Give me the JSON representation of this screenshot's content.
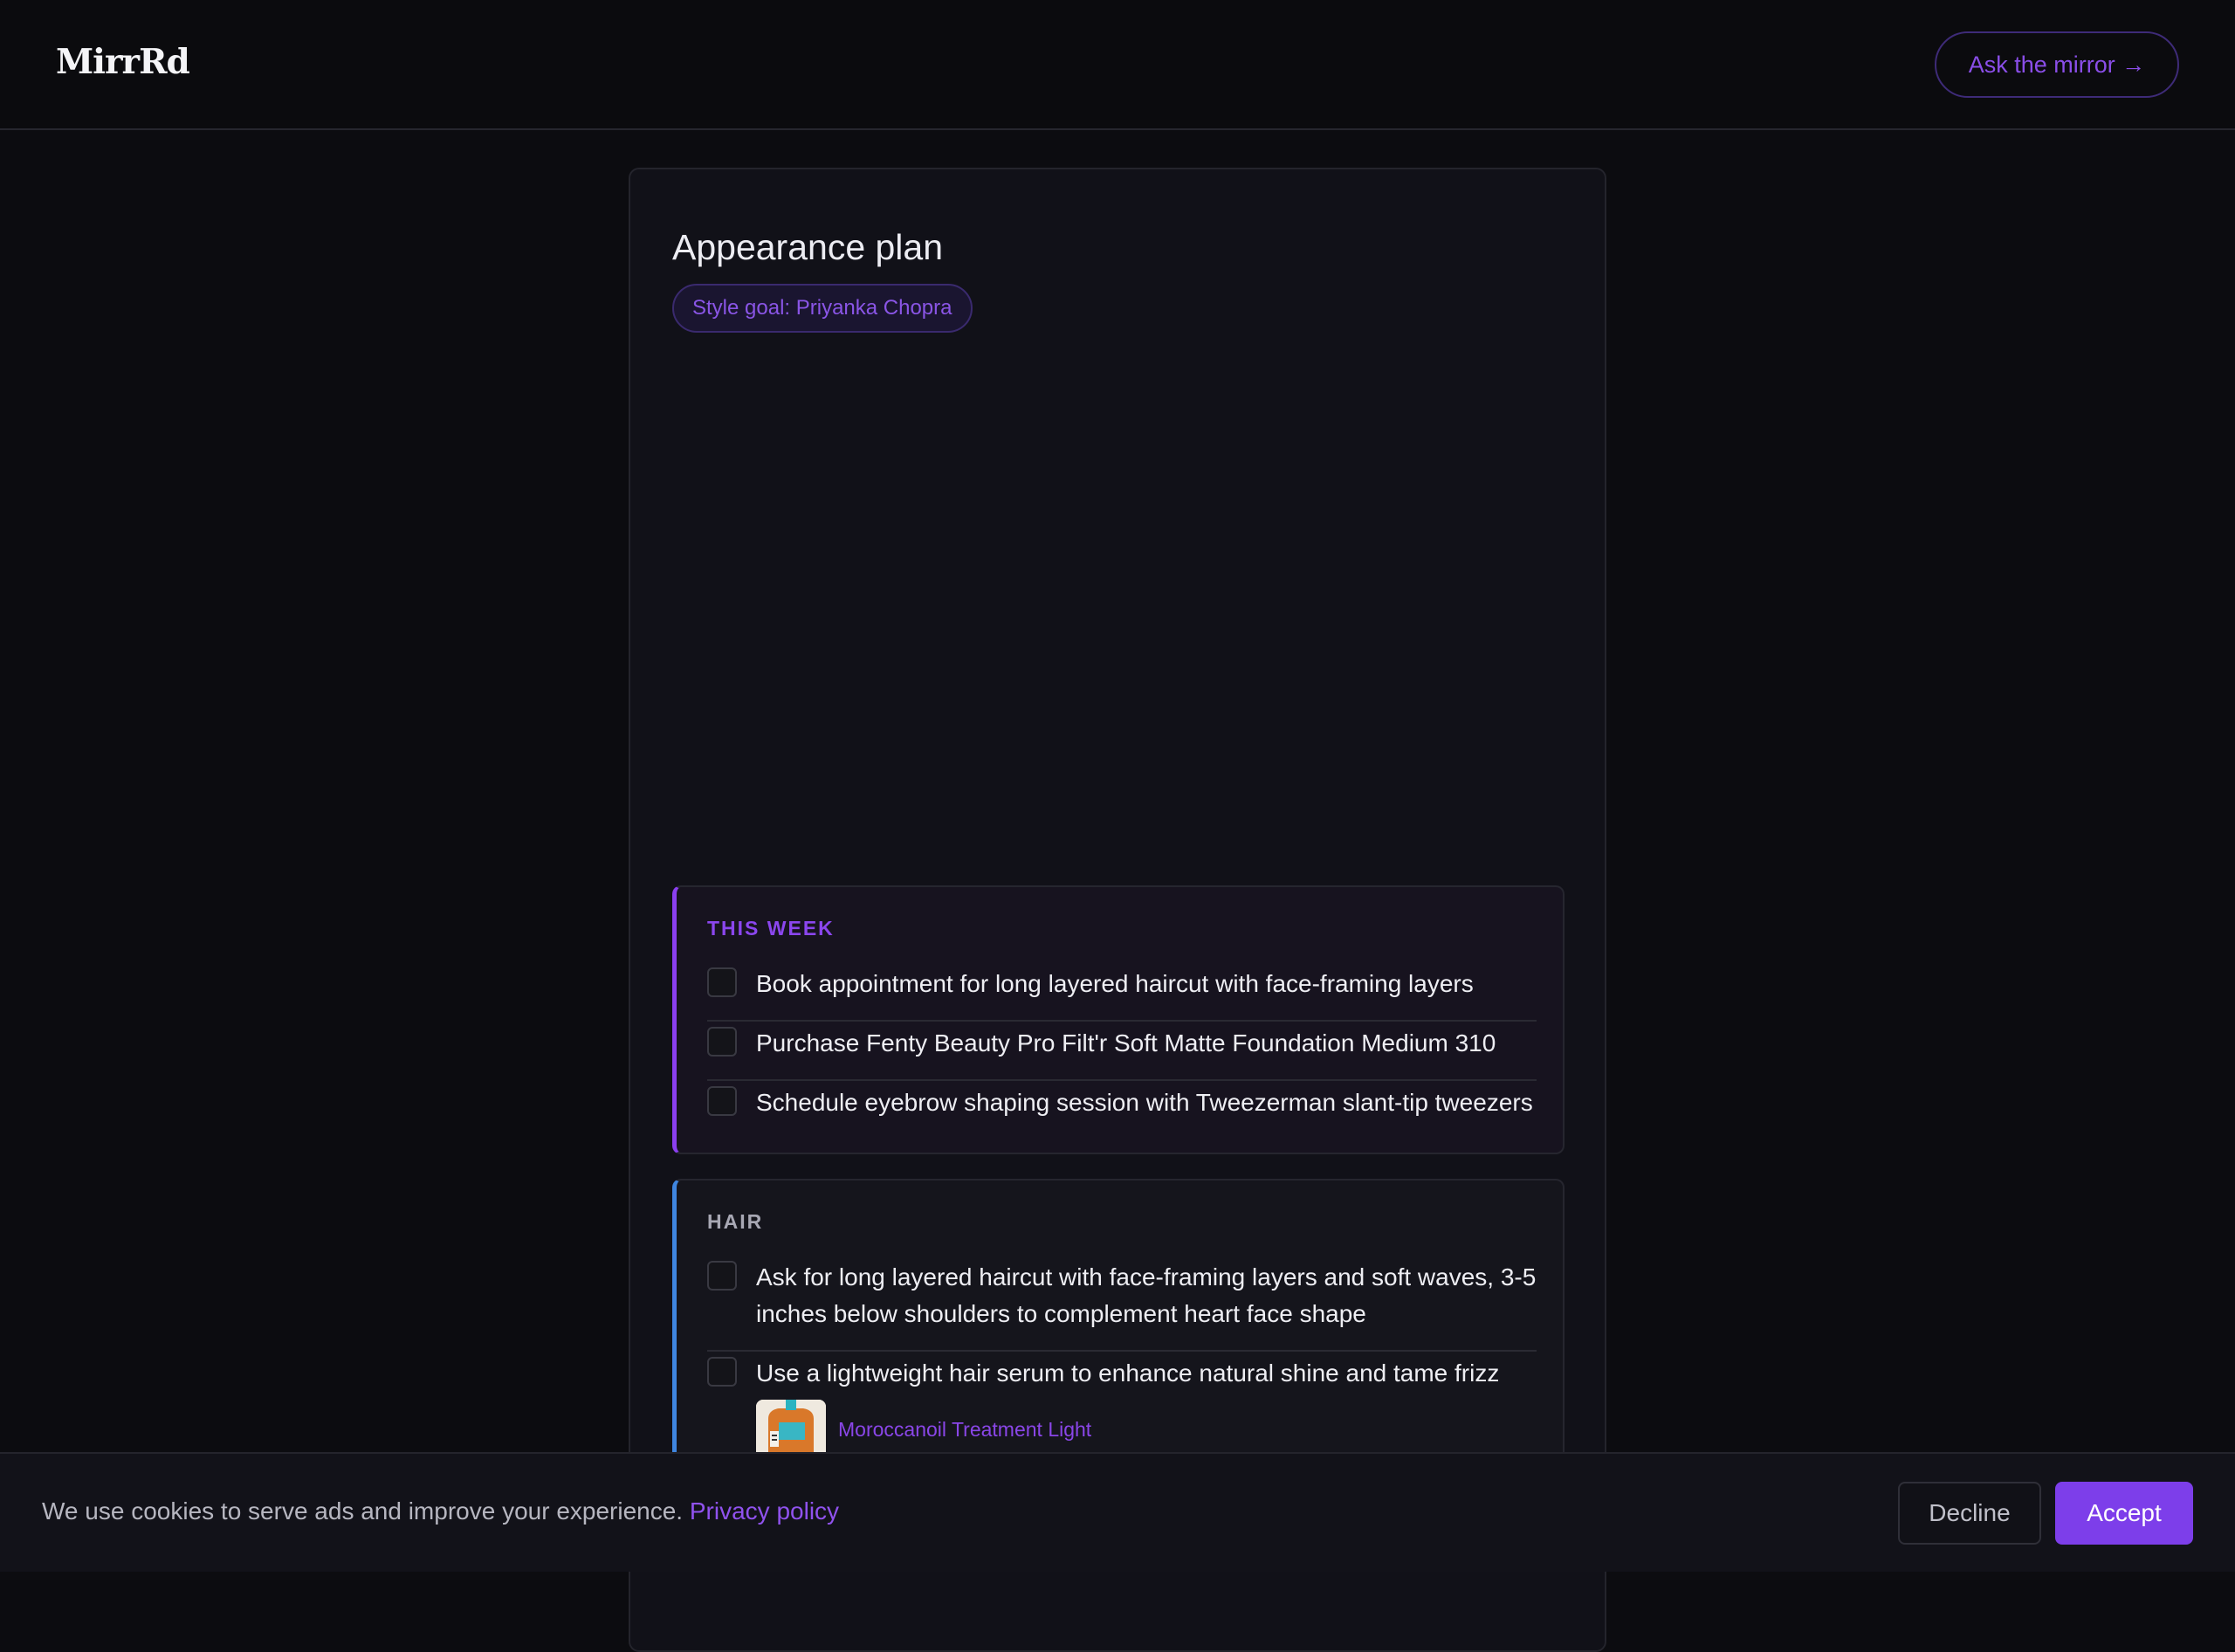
{
  "header": {
    "logo": "MirrRd",
    "ask_button": "Ask the mirror →"
  },
  "plan": {
    "title": "Appearance plan",
    "style_goal": "Style goal: Priyanka Chopra"
  },
  "sections": {
    "this_week": {
      "label": "THIS WEEK",
      "accent": "#8b3ff0",
      "tasks": [
        {
          "text": "Book appointment for long layered haircut with face-framing layers",
          "checked": false
        },
        {
          "text": "Purchase Fenty Beauty Pro Filt'r Soft Matte Foundation Medium 310",
          "checked": false
        },
        {
          "text": "Schedule eyebrow shaping session with Tweezerman slant-tip tweezers",
          "checked": false
        }
      ]
    },
    "hair": {
      "label": "HAIR",
      "accent": "#3f86e0",
      "tasks": [
        {
          "text": "Ask for long layered haircut with face-framing layers and soft waves, 3-5 inches below shoulders to complement heart face shape",
          "checked": false
        },
        {
          "text": "Use a lightweight hair serum to enhance natural shine and tame frizz",
          "checked": false
        }
      ],
      "product": {
        "name": "Moroccanoil Treatment Light",
        "icon": "product-bottle-icon"
      }
    }
  },
  "cookie_banner": {
    "message": "We use cookies to serve ads and improve your experience.",
    "link": "Privacy policy",
    "decline": "Decline",
    "accept": "Accept"
  },
  "colors": {
    "background": "#0c0c10",
    "accent_purple": "#7d3eea",
    "accent_blue": "#3f86e0"
  }
}
